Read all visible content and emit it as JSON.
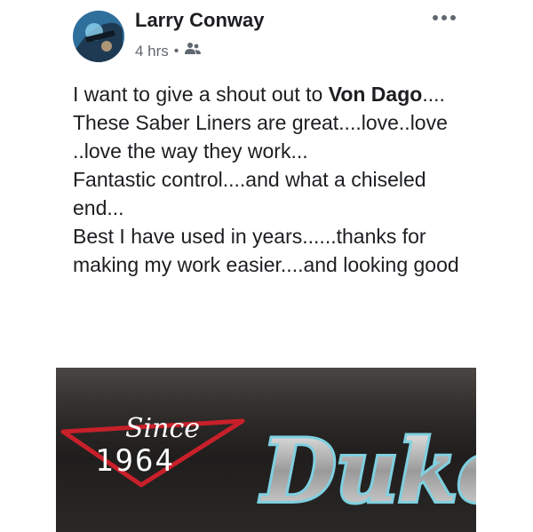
{
  "post": {
    "author": "Larry Conway",
    "timestamp": "4 hrs",
    "separator": "•",
    "audience_icon": "friends-icon",
    "more_icon": "more-options-icon",
    "paragraphs": [
      {
        "prefix": "I want to give a shout out to ",
        "bold": "Von Dago",
        "suffix": "...."
      },
      {
        "text": "These Saber Liners are great....love..love ..love the way they work..."
      },
      {
        "text": "Fantastic control....and what a chiseled end..."
      },
      {
        "text": "Best I have used in years......thanks for making my work easier....and looking good"
      }
    ]
  },
  "media": {
    "since_text": "Since",
    "year_text": "1964",
    "brand_text": "Duke",
    "accent_color": "#c8202a",
    "brand_color": "#7fd0e0"
  }
}
